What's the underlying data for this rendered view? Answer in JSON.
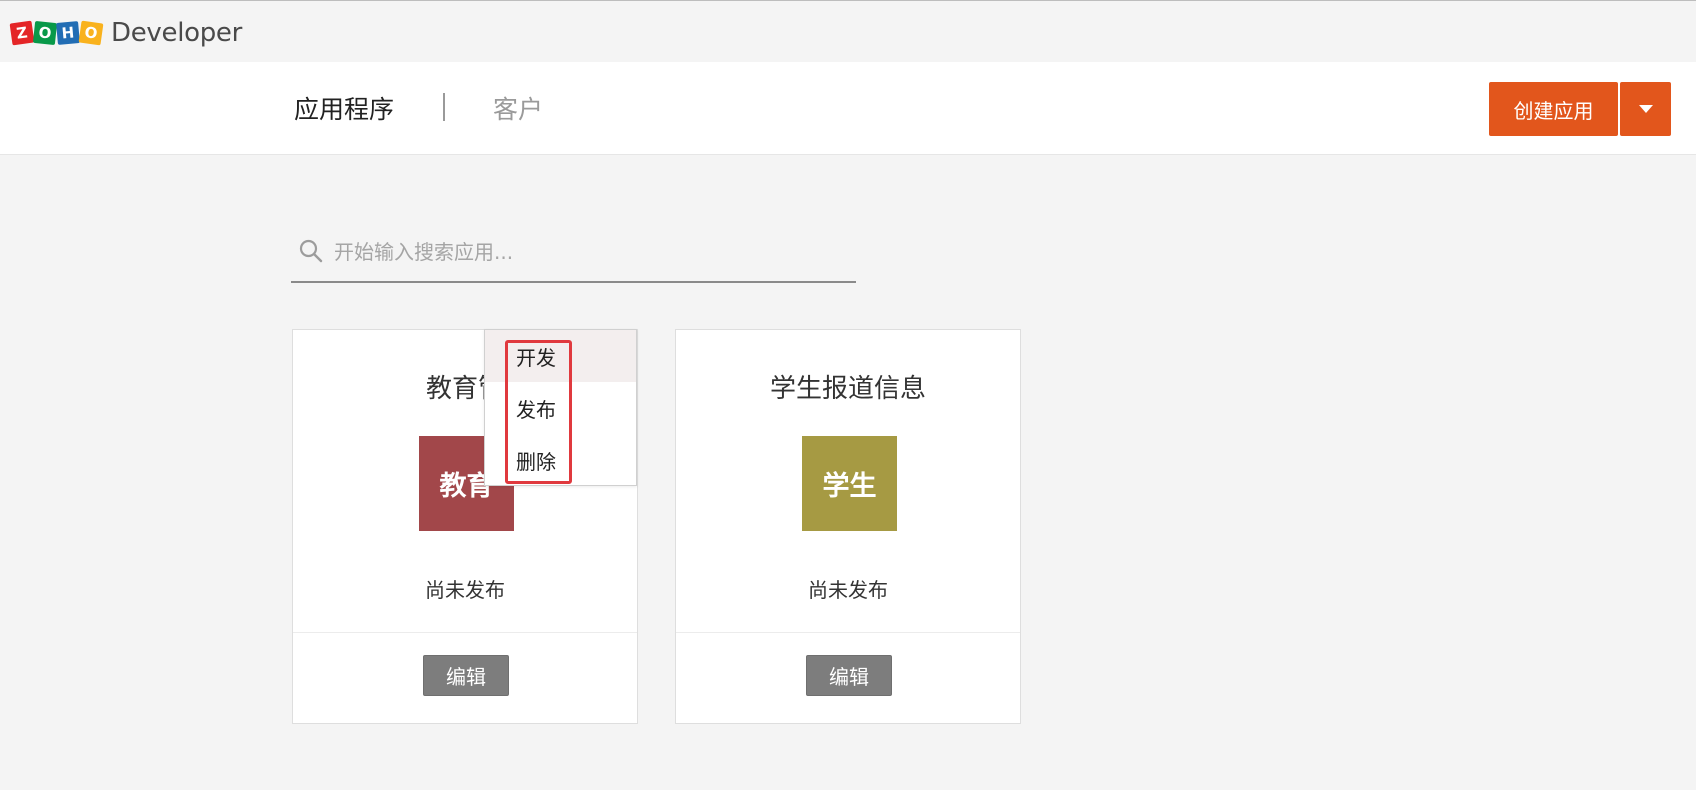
{
  "header": {
    "logo_letters": [
      "Z",
      "O",
      "H",
      "O"
    ],
    "logo_text": "Developer"
  },
  "nav": {
    "apps_tab": "应用程序",
    "clients_tab": "客户",
    "create_label": "创建应用"
  },
  "search": {
    "placeholder": "开始输入搜索应用..."
  },
  "apps": [
    {
      "title": "教育管",
      "icon_text": "教育",
      "icon_color": "#a2474a",
      "status": "尚未发布",
      "edit_label": "编辑"
    },
    {
      "title": "学生报道信息",
      "icon_text": "学生",
      "icon_color": "#a69a43",
      "status": "尚未发布",
      "edit_label": "编辑"
    }
  ],
  "context_menu": {
    "items": [
      "开发",
      "发布",
      "删除"
    ],
    "highlight_color": "#e0393e"
  },
  "colors": {
    "accent": "#e2561c",
    "background": "#f4f4f4"
  }
}
